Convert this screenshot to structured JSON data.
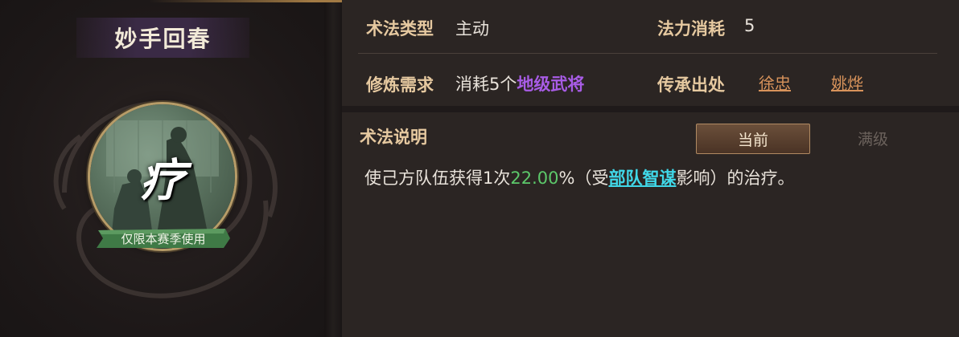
{
  "skill": {
    "name": "妙手回春",
    "icon_char": "疗",
    "season_badge": "仅限本赛季使用"
  },
  "info": {
    "type_label": "术法类型",
    "type_value": "主动",
    "cost_label": "法力消耗",
    "cost_value": "5",
    "req_label": "修炼需求",
    "req_prefix": "消耗5个",
    "req_highlight": "地级武将",
    "source_label": "传承出处",
    "sources": [
      "徐忠",
      "姚烨"
    ]
  },
  "description": {
    "title": "术法说明",
    "tabs": [
      "当前",
      "满级"
    ],
    "active_tab": "当前",
    "text_before": "使己方队伍获得1次",
    "value": "22.00",
    "text_middle": "%（受",
    "attribute": "部队智谋",
    "text_after": "影响）的治疗。"
  },
  "colors": {
    "label": "#e6c9a0",
    "purple": "#a85ce6",
    "green": "#5cc86a",
    "cyan": "#40d8e8",
    "link": "#d8935b"
  }
}
